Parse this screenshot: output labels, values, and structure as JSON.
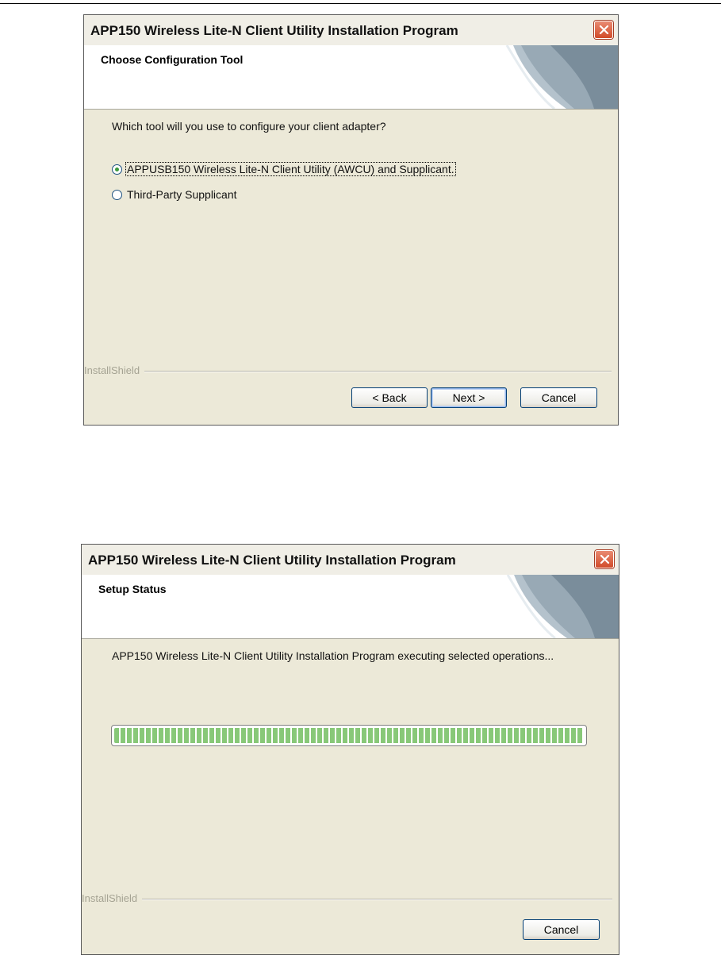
{
  "dialog1": {
    "title": "APP150 Wireless Lite-N Client Utility Installation Program",
    "banner_title": "Choose Configuration Tool",
    "question": "Which tool will you use to configure your client adapter?",
    "options": [
      {
        "label": "APPUSB150 Wireless Lite-N Client Utility (AWCU) and Supplicant.",
        "checked": true
      },
      {
        "label": "Third-Party Supplicant",
        "checked": false
      }
    ],
    "brand": "InstallShield",
    "buttons": {
      "back": "< Back",
      "next": "Next >",
      "cancel": "Cancel"
    }
  },
  "dialog2": {
    "title": "APP150 Wireless Lite-N Client Utility Installation Program",
    "banner_title": "Setup Status",
    "status_text": "APP150 Wireless Lite-N Client Utility Installation Program executing selected operations...",
    "progress_fraction": 1.0,
    "brand": "InstallShield",
    "buttons": {
      "cancel": "Cancel"
    }
  },
  "colors": {
    "dialog_bg": "#ece9d8",
    "close_red": "#d14b2a",
    "progress_green": "#88c878"
  }
}
